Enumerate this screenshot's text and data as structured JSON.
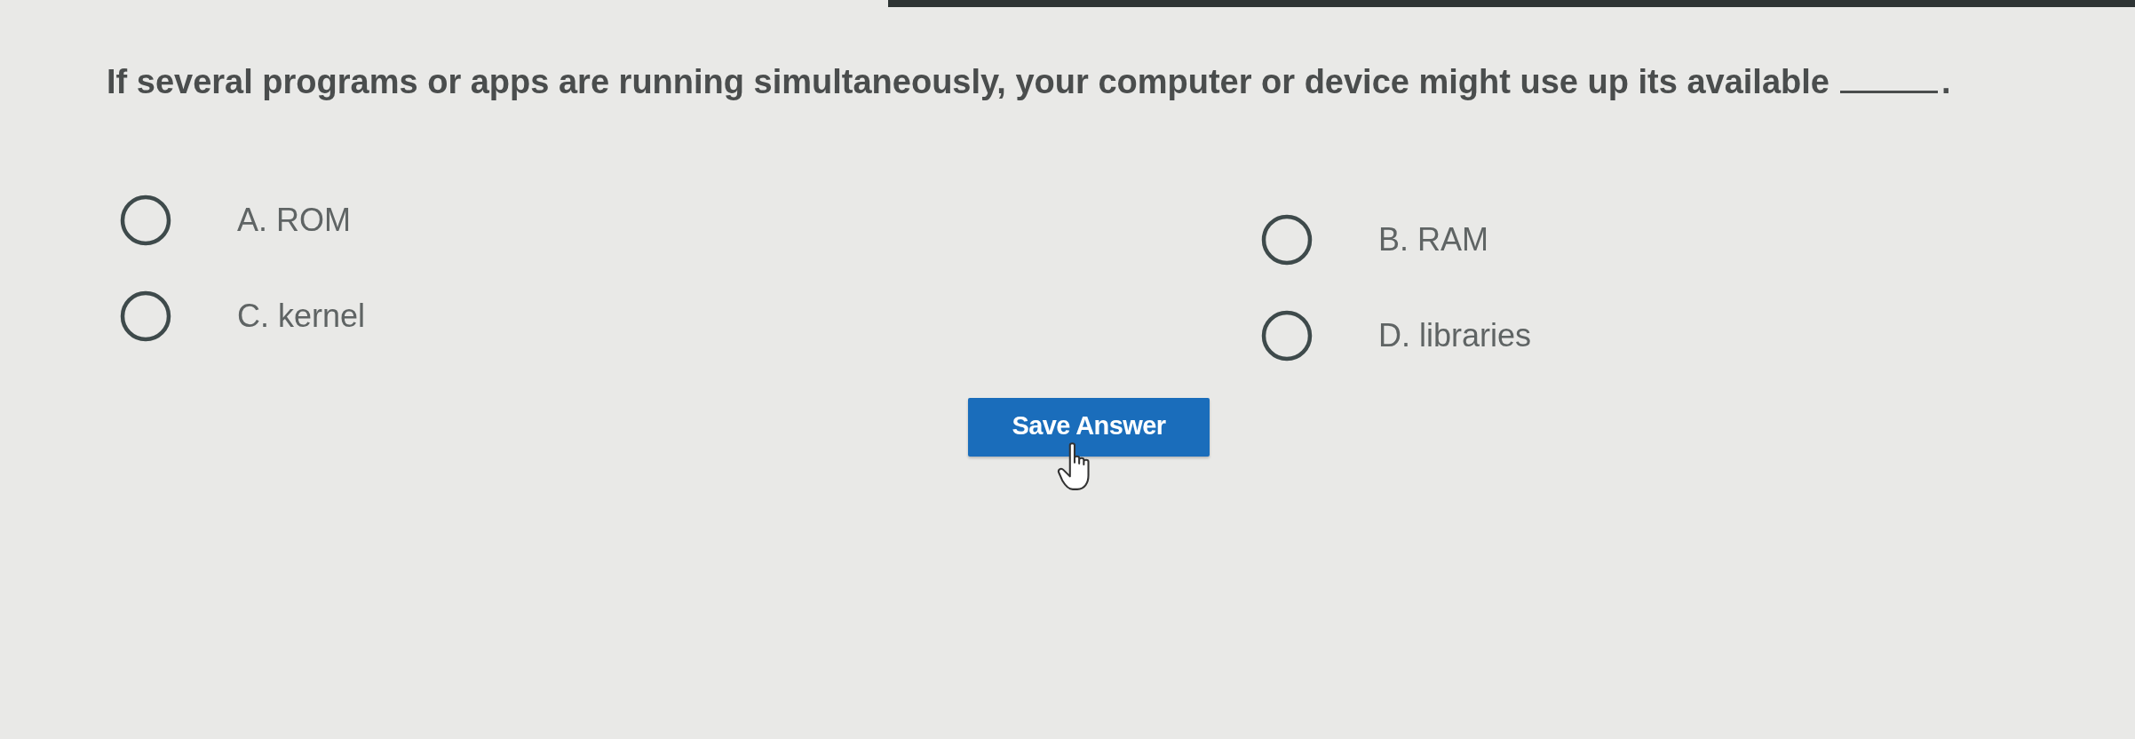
{
  "question": {
    "text": "If several programs or apps are running simultaneously, your computer or device might use up its available",
    "end": "."
  },
  "options": [
    {
      "label": "A. ROM",
      "selected": false
    },
    {
      "label": "B. RAM",
      "selected": false
    },
    {
      "label": "C. kernel",
      "selected": false
    },
    {
      "label": "D. libraries",
      "selected": false
    }
  ],
  "save_button": {
    "label": "Save Answer"
  }
}
